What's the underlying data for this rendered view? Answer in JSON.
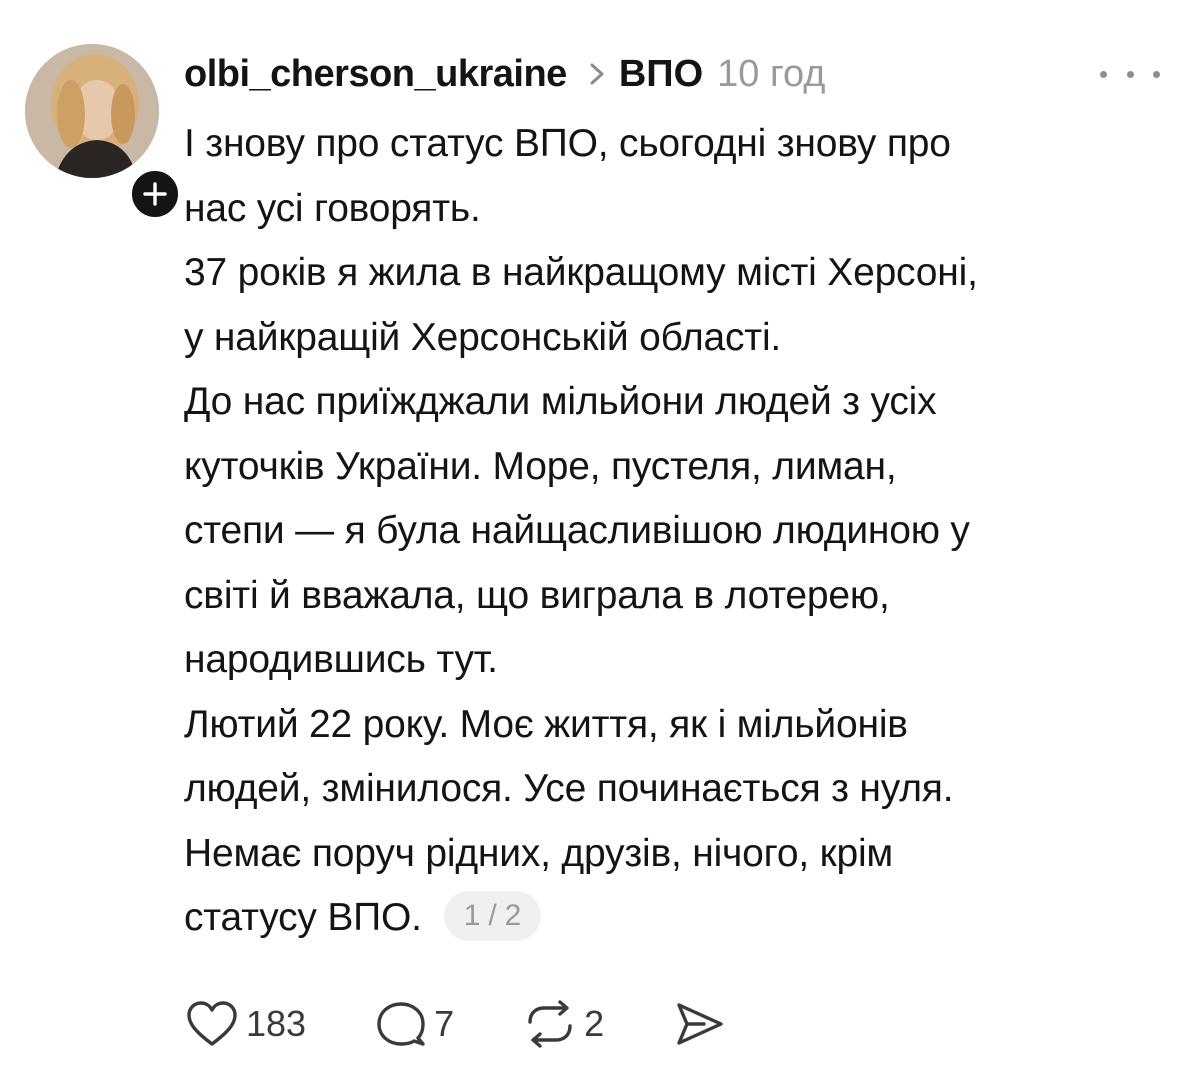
{
  "post": {
    "username": "olbi_cherson_ukraine",
    "topic": "ВПО",
    "time": "10 год",
    "lines": [
      "І знову про статус ВПО, сьогодні знову про",
      "нас усі говорять.",
      "37 років я жила в найкращому місті Херсоні,",
      "у найкращій Херсонській області.",
      "До нас приїжджали мільйони людей з усіх",
      "куточків України. Море, пустеля, лиман,",
      "степи — я була найщасливішою людиною у",
      "світі й вважала, що виграла в лотерею,",
      "народившись тут.",
      "Лютий 22 року. Моє життя, як і мільйонів",
      "людей, змінилося. Усе починається з нуля.",
      "Немає поруч рідних, друзів, нічого, крім",
      "статусу ВПО."
    ],
    "page_indicator": "1 / 2"
  },
  "actions": {
    "likes": "183",
    "replies": "7",
    "reposts": "2"
  },
  "icons": {
    "chevron": "chevron-right-icon",
    "more": "more-horizontal-icon",
    "like": "heart-icon",
    "reply": "comment-icon",
    "repost": "repost-icon",
    "share": "send-icon",
    "follow": "plus-icon"
  },
  "colors": {
    "text": "#141414",
    "muted": "#9a9a9a",
    "pill_bg": "#f0f0f0"
  }
}
